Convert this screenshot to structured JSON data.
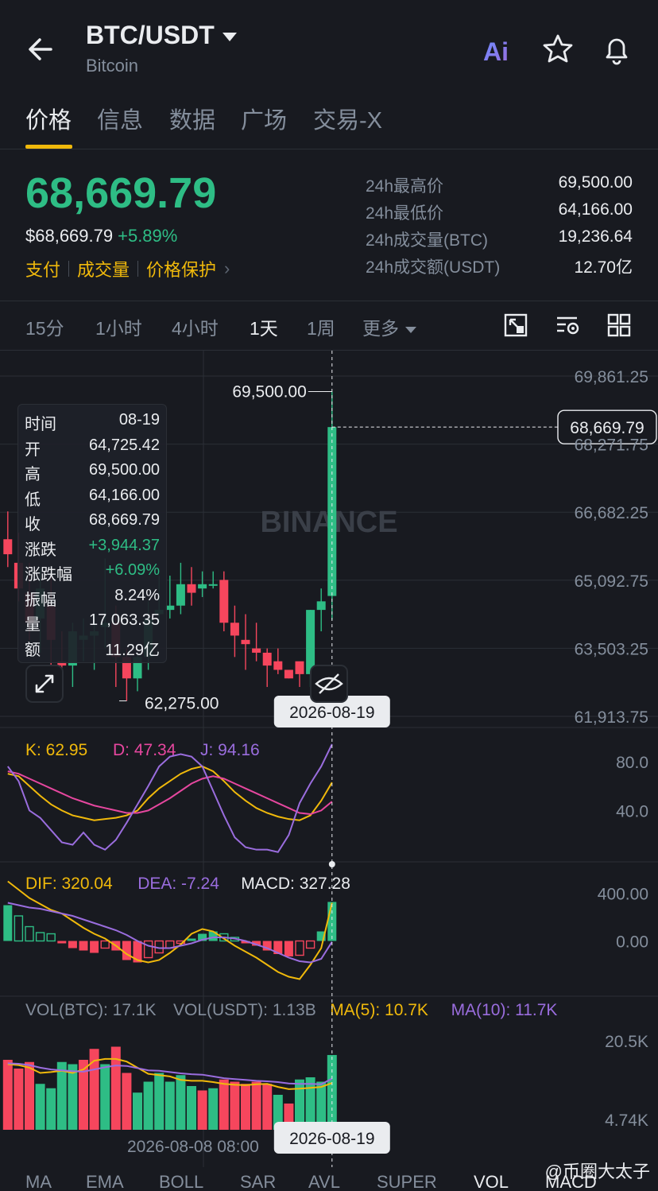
{
  "header": {
    "pair": "BTC/USDT",
    "name": "Bitcoin",
    "ai_label": "Ai"
  },
  "tabs": [
    {
      "label": "价格",
      "active": true
    },
    {
      "label": "信息"
    },
    {
      "label": "数据"
    },
    {
      "label": "广场"
    },
    {
      "label": "交易-X"
    }
  ],
  "price": {
    "last": "68,669.79",
    "fiat": "$68,669.79",
    "change_pct": "+5.89%",
    "links": [
      "支付",
      "成交量",
      "价格保护"
    ]
  },
  "stats": [
    {
      "label": "24h最高价",
      "value": "69,500.00"
    },
    {
      "label": "24h最低价",
      "value": "64,166.00"
    },
    {
      "label": "24h成交量(BTC)",
      "value": "19,236.64"
    },
    {
      "label": "24h成交额(USDT)",
      "value": "12.70亿"
    }
  ],
  "intervals": [
    {
      "label": "15分"
    },
    {
      "label": "1小时"
    },
    {
      "label": "4小时"
    },
    {
      "label": "1天",
      "active": true
    },
    {
      "label": "1周"
    },
    {
      "label": "更多"
    }
  ],
  "ohlc": [
    {
      "k": "时间",
      "v": "08-19"
    },
    {
      "k": "开",
      "v": "64,725.42"
    },
    {
      "k": "高",
      "v": "69,500.00"
    },
    {
      "k": "低",
      "v": "64,166.00"
    },
    {
      "k": "收",
      "v": "68,669.79"
    },
    {
      "k": "涨跌",
      "v": "+3,944.37",
      "green": true
    },
    {
      "k": "涨跌幅",
      "v": "+6.09%",
      "green": true
    },
    {
      "k": "振幅",
      "v": "8.24%"
    },
    {
      "k": "量",
      "v": "17,063.35"
    },
    {
      "k": "额",
      "v": "11.29亿"
    }
  ],
  "colors": {
    "up": "#2ebd85",
    "down": "#f6465d",
    "accent": "#f0b90b",
    "purple": "#9a6dde",
    "pink": "#e6479f"
  },
  "chart_data": [
    {
      "type": "candlestick",
      "y_ticks": [
        "69,861.25",
        "68,271.75",
        "66,682.25",
        "65,092.75",
        "63,503.25",
        "61,913.75"
      ],
      "ylim": [
        61913.75,
        69861.25
      ],
      "watermark": "BINANCE",
      "high_label": "69,500.00",
      "low_label": "62,275.00",
      "current_price": "68,669.79",
      "crosshair_date": "2026-08-19",
      "candles": [
        {
          "o": 66050,
          "h": 66700,
          "l": 65400,
          "c": 65700
        },
        {
          "o": 65500,
          "h": 66200,
          "l": 64600,
          "c": 64900
        },
        {
          "o": 64800,
          "h": 65500,
          "l": 63700,
          "c": 64100
        },
        {
          "o": 64200,
          "h": 65400,
          "l": 63400,
          "c": 64900
        },
        {
          "o": 64500,
          "h": 65200,
          "l": 63000,
          "c": 63700
        },
        {
          "o": 63200,
          "h": 63900,
          "l": 62600,
          "c": 63100
        },
        {
          "o": 63100,
          "h": 64100,
          "l": 62600,
          "c": 63900
        },
        {
          "o": 63700,
          "h": 64200,
          "l": 63200,
          "c": 63800
        },
        {
          "o": 63800,
          "h": 64300,
          "l": 63000,
          "c": 63900
        },
        {
          "o": 64000,
          "h": 65600,
          "l": 63500,
          "c": 64100
        },
        {
          "o": 64100,
          "h": 64500,
          "l": 62600,
          "c": 63300
        },
        {
          "o": 63300,
          "h": 63500,
          "l": 62275,
          "c": 62800
        },
        {
          "o": 62800,
          "h": 63400,
          "l": 62500,
          "c": 63300
        },
        {
          "o": 63300,
          "h": 64600,
          "l": 63000,
          "c": 64200
        },
        {
          "o": 64300,
          "h": 65200,
          "l": 64100,
          "c": 64400
        },
        {
          "o": 64400,
          "h": 65200,
          "l": 64200,
          "c": 64500
        },
        {
          "o": 64500,
          "h": 65500,
          "l": 64300,
          "c": 65000
        },
        {
          "o": 65000,
          "h": 65400,
          "l": 64500,
          "c": 64800
        },
        {
          "o": 64900,
          "h": 65300,
          "l": 64700,
          "c": 65000
        },
        {
          "o": 65000,
          "h": 65300,
          "l": 64900,
          "c": 65000
        },
        {
          "o": 65100,
          "h": 65300,
          "l": 63900,
          "c": 64100
        },
        {
          "o": 64100,
          "h": 64500,
          "l": 63300,
          "c": 63800
        },
        {
          "o": 63700,
          "h": 64300,
          "l": 63000,
          "c": 63600
        },
        {
          "o": 63500,
          "h": 64100,
          "l": 63200,
          "c": 63400
        },
        {
          "o": 63400,
          "h": 63500,
          "l": 62600,
          "c": 63100
        },
        {
          "o": 63200,
          "h": 63500,
          "l": 62900,
          "c": 63000
        },
        {
          "o": 63000,
          "h": 63000,
          "l": 62800,
          "c": 62800
        },
        {
          "o": 63200,
          "h": 63100,
          "l": 62600,
          "c": 62900
        },
        {
          "o": 62900,
          "h": 64400,
          "l": 62600,
          "c": 64400
        },
        {
          "o": 64400,
          "h": 64900,
          "l": 63900,
          "c": 64600
        },
        {
          "o": 64725.42,
          "h": 69500,
          "l": 64166,
          "c": 68669.79
        }
      ]
    },
    {
      "type": "line",
      "title": "KDJ",
      "legend": [
        {
          "name": "K: 62.95",
          "color": "#f0b90b"
        },
        {
          "name": "D: 47.34",
          "color": "#e6479f"
        },
        {
          "name": "J: 94.16",
          "color": "#9a6dde"
        }
      ],
      "y_ticks": [
        "80.0",
        "40.0"
      ],
      "ylim": [
        0,
        100
      ],
      "series": [
        {
          "name": "K",
          "values": [
            70,
            68,
            60,
            52,
            45,
            40,
            36,
            34,
            32,
            33,
            34,
            36,
            40,
            50,
            58,
            64,
            70,
            74,
            76,
            72,
            64,
            55,
            48,
            42,
            38,
            35,
            33,
            32,
            36,
            48,
            62.95
          ]
        },
        {
          "name": "D",
          "values": [
            72,
            70,
            66,
            62,
            58,
            54,
            50,
            47,
            44,
            42,
            40,
            38,
            38,
            40,
            45,
            50,
            56,
            62,
            66,
            68,
            66,
            62,
            58,
            54,
            50,
            46,
            42,
            38,
            37,
            40,
            47.34
          ]
        },
        {
          "name": "J",
          "values": [
            76,
            64,
            40,
            34,
            24,
            14,
            12,
            22,
            12,
            8,
            16,
            30,
            45,
            60,
            76,
            84,
            86,
            84,
            76,
            56,
            36,
            18,
            10,
            8,
            8,
            6,
            20,
            46,
            62,
            76,
            94.16
          ]
        }
      ]
    },
    {
      "type": "bar",
      "title": "MACD",
      "legend": [
        {
          "name": "DIF: 320.04",
          "color": "#f0b90b"
        },
        {
          "name": "DEA: -7.24",
          "color": "#9a6dde"
        },
        {
          "name": "MACD: 327.28",
          "color": "#eaecef"
        }
      ],
      "y_ticks": [
        "400.00",
        "0.00"
      ],
      "ylim": [
        -450,
        550
      ],
      "histogram": [
        300,
        210,
        120,
        70,
        60,
        -20,
        -60,
        -80,
        -100,
        -60,
        -80,
        -160,
        -180,
        -140,
        -100,
        -60,
        -20,
        20,
        60,
        80,
        60,
        30,
        -20,
        -40,
        -80,
        -110,
        -130,
        -120,
        -60,
        80,
        327.28
      ],
      "dif": [
        500,
        430,
        360,
        310,
        260,
        230,
        170,
        110,
        60,
        20,
        -40,
        -110,
        -160,
        -180,
        -160,
        -100,
        -30,
        60,
        100,
        80,
        20,
        -40,
        -90,
        -140,
        -200,
        -260,
        -300,
        -320,
        -200,
        -60,
        320.04
      ],
      "dea": [
        320,
        300,
        280,
        270,
        250,
        230,
        210,
        180,
        150,
        120,
        90,
        50,
        0,
        -40,
        -60,
        -60,
        -40,
        -20,
        10,
        30,
        30,
        20,
        0,
        -30,
        -60,
        -100,
        -140,
        -170,
        -180,
        -150,
        -7.24
      ]
    },
    {
      "type": "bar",
      "title": "VOL",
      "legend": [
        {
          "name": "VOL(BTC): 17.1K",
          "color": "#848e9c"
        },
        {
          "name": "VOL(USDT): 1.13B",
          "color": "#848e9c"
        },
        {
          "name": "MA(5): 10.7K",
          "color": "#f0b90b"
        },
        {
          "name": "MA(10): 11.7K",
          "color": "#9a6dde"
        }
      ],
      "y_ticks": [
        "20.5K",
        "4.74K"
      ],
      "ylim": [
        0,
        24000
      ],
      "x_label": "2026-08-08 08:00",
      "values": [
        16000,
        14000,
        15500,
        10500,
        9500,
        15500,
        15000,
        16000,
        18500,
        15000,
        19000,
        13000,
        8500,
        11000,
        13000,
        11000,
        12500,
        10000,
        9000,
        9500,
        11500,
        11000,
        10500,
        11000,
        10500,
        8000,
        6000,
        11500,
        12000,
        11000,
        17100
      ],
      "up": [
        false,
        false,
        false,
        true,
        true,
        true,
        true,
        false,
        false,
        true,
        false,
        false,
        true,
        true,
        true,
        true,
        true,
        true,
        false,
        true,
        false,
        false,
        false,
        false,
        false,
        true,
        false,
        true,
        true,
        true,
        true
      ],
      "ma5": [
        15000,
        14800,
        14200,
        13000,
        13200,
        13500,
        13000,
        13800,
        15800,
        16200,
        16200,
        15600,
        14200,
        12800,
        12500,
        12200,
        11400,
        11200,
        11200,
        10900,
        10500,
        10300,
        10200,
        10400,
        10500,
        9800,
        9300,
        9400,
        9600,
        9800,
        10700
      ],
      "ma10": [
        15200,
        15100,
        14800,
        14200,
        13800,
        13600,
        13400,
        13300,
        13800,
        14300,
        14700,
        14600,
        14100,
        13600,
        13500,
        13200,
        12900,
        12700,
        12600,
        12200,
        11800,
        11600,
        11400,
        11200,
        11100,
        10900,
        10600,
        10500,
        10500,
        10400,
        11700
      ]
    }
  ],
  "indicators": [
    {
      "label": "MA"
    },
    {
      "label": "EMA"
    },
    {
      "label": "BOLL"
    },
    {
      "label": "SAR"
    },
    {
      "label": "AVL"
    },
    {
      "label": "SUPER"
    },
    {
      "label": "VOL",
      "active": true
    },
    {
      "label": "MACD",
      "active": true
    }
  ],
  "watermark2": "@币圈大太子"
}
